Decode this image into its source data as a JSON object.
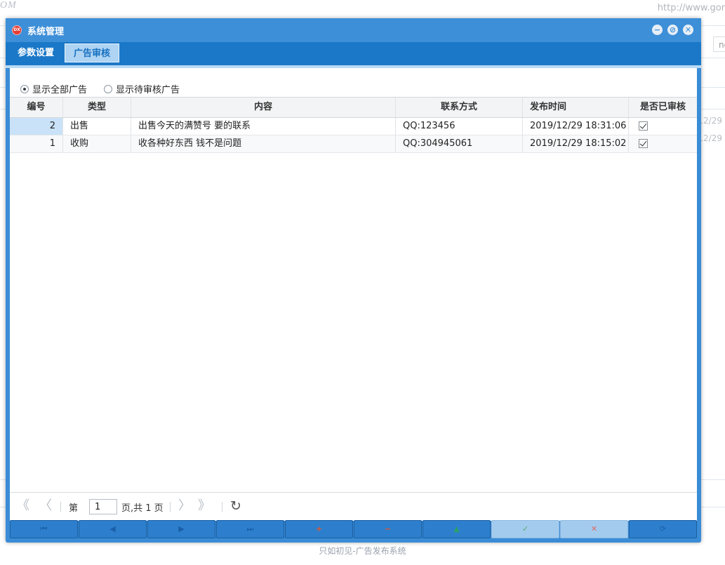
{
  "background": {
    "logo": "OM",
    "url": "http://www.gor",
    "input_text": "no",
    "dates": [
      "12/29",
      "12/29"
    ],
    "footer": "只如初见-广告发布系统"
  },
  "dialog": {
    "title": "系统管理",
    "icon": "app-logo-icon",
    "window_buttons": [
      "minimize-icon",
      "maximize-icon",
      "close-icon"
    ]
  },
  "tabs": [
    {
      "label": "参数设置",
      "active": false
    },
    {
      "label": "广告审核",
      "active": true
    }
  ],
  "filter": {
    "options": [
      {
        "label": "显示全部广告",
        "checked": true
      },
      {
        "label": "显示待审核广告",
        "checked": false
      }
    ]
  },
  "grid": {
    "columns": [
      "编号",
      "类型",
      "内容",
      "联系方式",
      "发布时间",
      "是否已审核"
    ],
    "rows": [
      {
        "id": "2",
        "type": "出售",
        "content": "出售今天的满赞号 要的联系",
        "contact": "QQ:123456",
        "time": "2019/12/29 18:31:06",
        "approved": true
      },
      {
        "id": "1",
        "type": "收购",
        "content": "收各种好东西 钱不是问题",
        "contact": "QQ:304945061",
        "time": "2019/12/29 18:15:02",
        "approved": true
      }
    ]
  },
  "pager": {
    "prefix": "第",
    "page": "1",
    "suffix": "页,共 1 页"
  },
  "toolbar": {
    "buttons": [
      {
        "name": "first-record-button",
        "icon": "first-icon",
        "glyph": "⏮",
        "color": "#1a5fa8"
      },
      {
        "name": "prev-record-button",
        "icon": "prev-icon",
        "glyph": "◀",
        "color": "#1a5fa8"
      },
      {
        "name": "next-record-button",
        "icon": "next-icon",
        "glyph": "▶",
        "color": "#1a5fa8"
      },
      {
        "name": "last-record-button",
        "icon": "last-icon",
        "glyph": "⏭",
        "color": "#1a5fa8"
      },
      {
        "name": "add-button",
        "icon": "plus-icon",
        "glyph": "+",
        "color": "#e2552c"
      },
      {
        "name": "delete-button",
        "icon": "minus-icon",
        "glyph": "−",
        "color": "#e2552c"
      },
      {
        "name": "edit-button",
        "icon": "caret-up-icon",
        "glyph": "▲",
        "color": "#2aa06a"
      },
      {
        "name": "save-button",
        "icon": "check-icon",
        "glyph": "✓",
        "color": "#5aaa6a"
      },
      {
        "name": "cancel-button",
        "icon": "x-icon",
        "glyph": "✕",
        "color": "#e06a66"
      },
      {
        "name": "refresh-button",
        "icon": "refresh-icon",
        "glyph": "⟳",
        "color": "#1a5fa8"
      }
    ]
  }
}
